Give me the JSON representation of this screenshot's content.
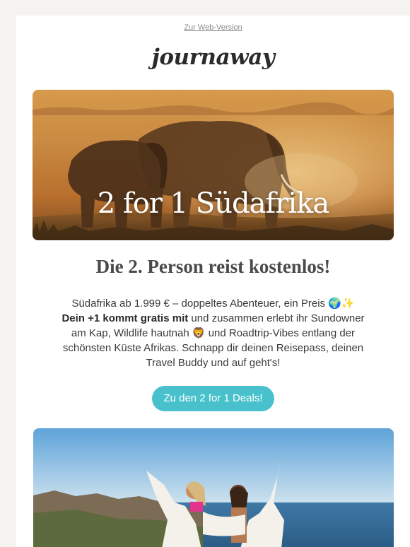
{
  "header": {
    "web_version_link": "Zur Web-Version",
    "logo": "journaway"
  },
  "hero": {
    "title": "2 for 1 Südafrika",
    "image": "elephants-in-savanna"
  },
  "main": {
    "headline": "Die 2. Person reist kostenlos!",
    "intro_line": "Südafrika ab 1.999 € – doppeltes Abenteuer, ein Preis 🌍✨",
    "bold_part": "Dein +1 kommt gratis mit",
    "body_rest_1": " und zusammen erlebt ihr Sundowner am Kap, Wildlife hautnah 🦁 und Roadtrip-Vibes entlang der schönsten Küste Afrikas. Schnapp dir deinen Reisepass, deinen Travel Buddy und auf geht's!",
    "cta_label": "Zu den 2 for 1 Deals!"
  },
  "second_image": "two-travelers-cape-town-coast",
  "colors": {
    "cta": "#49c1cc",
    "headline": "#4a4a4a",
    "page_background": "#f4f3f0"
  }
}
